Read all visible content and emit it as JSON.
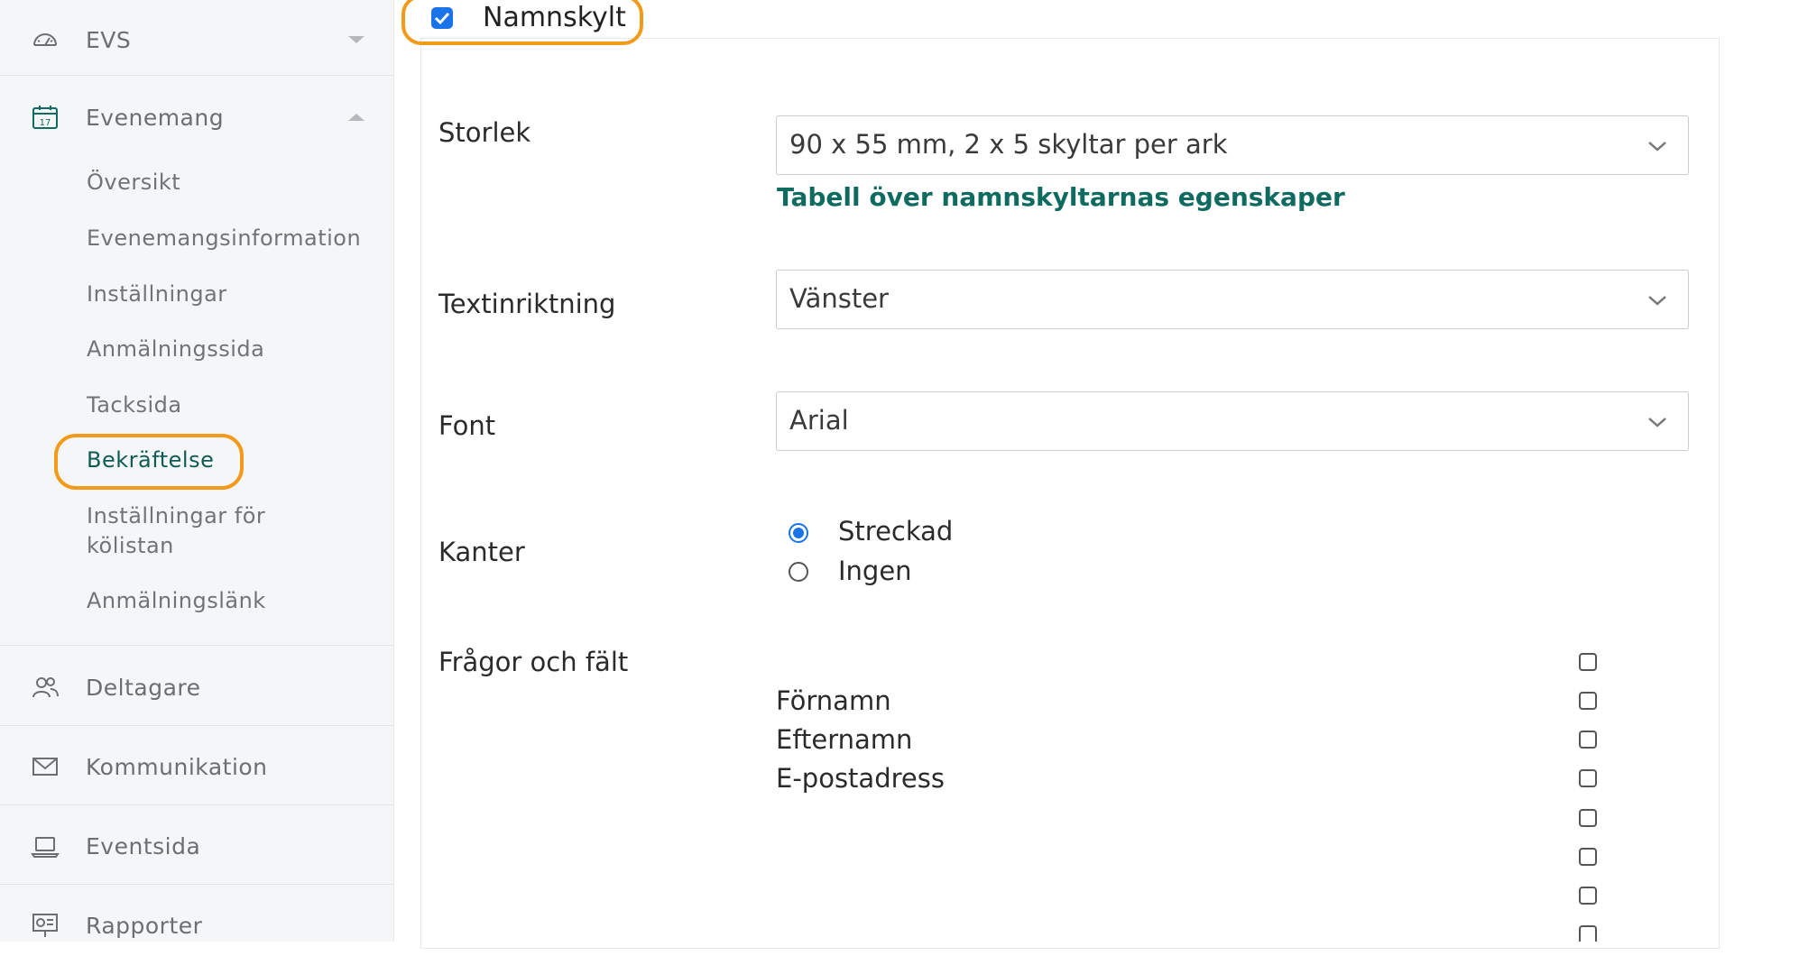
{
  "sidebar": {
    "items": [
      {
        "label": "EVS",
        "icon": "dashboard-gauge-icon",
        "chevron": "chevron-down-icon"
      },
      {
        "label": "Evenemang",
        "icon": "calendar-icon",
        "icon_text": "17",
        "chevron": "chevron-up-icon"
      },
      {
        "label": "Deltagare",
        "icon": "people-icon"
      },
      {
        "label": "Kommunikation",
        "icon": "envelope-icon"
      },
      {
        "label": "Eventsida",
        "icon": "laptop-icon"
      },
      {
        "label": "Rapporter",
        "icon": "presentation-chart-icon"
      }
    ],
    "sub_items": [
      {
        "label": "Översikt"
      },
      {
        "label": "Evenemangsinformation"
      },
      {
        "label": "Inställningar"
      },
      {
        "label": "Anmälningssida"
      },
      {
        "label": "Tacksida"
      },
      {
        "label": "Bekräftelse",
        "active": true
      },
      {
        "label_line1": "Inställningar för",
        "label_line2": "kölistan"
      },
      {
        "label": "Anmälningslänk"
      }
    ]
  },
  "main": {
    "namnskylt": {
      "label": "Namnskylt",
      "checked": true
    },
    "fields": {
      "storlek": {
        "label": "Storlek",
        "value": "90 x 55 mm, 2 x 5 skyltar per ark",
        "link": "Tabell över namnskyltarnas egenskaper"
      },
      "textinriktning": {
        "label": "Textinriktning",
        "value": "Vänster"
      },
      "font": {
        "label": "Font",
        "value": "Arial"
      },
      "kanter": {
        "label": "Kanter",
        "options": [
          {
            "label": "Streckad",
            "selected": true
          },
          {
            "label": "Ingen",
            "selected": false
          }
        ]
      },
      "fragor": {
        "label": "Frågor och fält",
        "items": [
          "Förnamn",
          "Efternamn",
          "E-postadress"
        ]
      }
    }
  },
  "colors": {
    "accent_green": "#0f6b5f",
    "highlight_orange": "#f39a1a",
    "checkbox_blue": "#1a73e8"
  }
}
